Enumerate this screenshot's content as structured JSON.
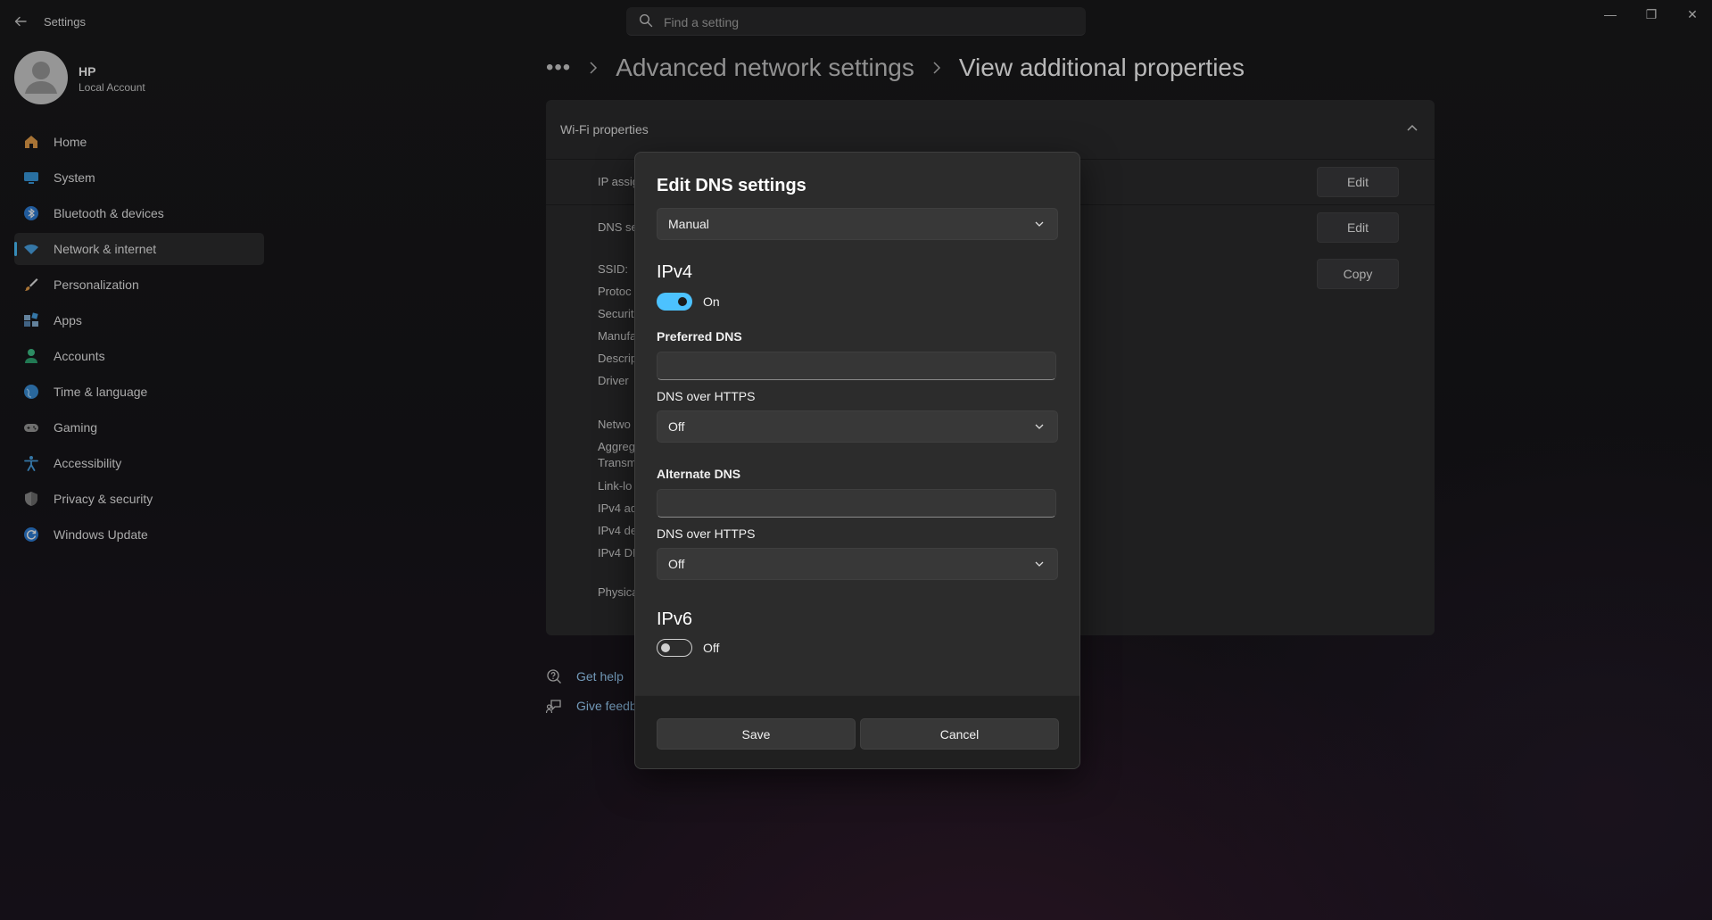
{
  "window": {
    "app_title": "Settings",
    "controls": {
      "minimize": "—",
      "maximize": "❐",
      "close": "✕"
    }
  },
  "search": {
    "placeholder": "Find a setting"
  },
  "profile": {
    "name": "HP",
    "account_type": "Local Account"
  },
  "sidebar": {
    "active": "Network & internet",
    "items": [
      {
        "label": "Home",
        "icon": "home-icon"
      },
      {
        "label": "System",
        "icon": "monitor-icon"
      },
      {
        "label": "Bluetooth & devices",
        "icon": "bluetooth-icon"
      },
      {
        "label": "Network & internet",
        "icon": "wifi-icon"
      },
      {
        "label": "Personalization",
        "icon": "brush-icon"
      },
      {
        "label": "Apps",
        "icon": "apps-icon"
      },
      {
        "label": "Accounts",
        "icon": "person-icon"
      },
      {
        "label": "Time & language",
        "icon": "globe-icon"
      },
      {
        "label": "Gaming",
        "icon": "gamepad-icon"
      },
      {
        "label": "Accessibility",
        "icon": "accessibility-icon"
      },
      {
        "label": "Privacy & security",
        "icon": "shield-icon"
      },
      {
        "label": "Windows Update",
        "icon": "update-icon"
      }
    ]
  },
  "breadcrumb": {
    "more": "•••",
    "items": [
      "Advanced network settings",
      "View additional properties"
    ]
  },
  "panel": {
    "title": "Wi-Fi properties",
    "rows": [
      {
        "label": "IP assig",
        "button": "Edit"
      },
      {
        "label": "DNS se",
        "button": "Edit"
      }
    ],
    "copy_button": "Copy",
    "properties": [
      "SSID:",
      "Protoc",
      "Securit",
      "Manufa",
      "Descrip",
      "Driver",
      "Netwo",
      "Aggreg",
      "Transm",
      "Link-lo",
      "IPv4 ad",
      "IPv4 de",
      "IPv4 DI",
      "Physica"
    ]
  },
  "help": {
    "get_help": "Get help",
    "give_feedback": "Give feedb"
  },
  "dialog": {
    "title": "Edit DNS settings",
    "mode": "Manual",
    "ipv4": {
      "heading": "IPv4",
      "toggle_state": "On",
      "preferred_label": "Preferred DNS",
      "preferred_value": "",
      "doh1_label": "DNS over HTTPS",
      "doh1_value": "Off",
      "alternate_label": "Alternate DNS",
      "alternate_value": "",
      "doh2_label": "DNS over HTTPS",
      "doh2_value": "Off"
    },
    "ipv6": {
      "heading": "IPv6",
      "toggle_state": "Off"
    },
    "save": "Save",
    "cancel": "Cancel"
  },
  "colors": {
    "accent": "#4cc2ff",
    "link": "#9fd4ff"
  }
}
